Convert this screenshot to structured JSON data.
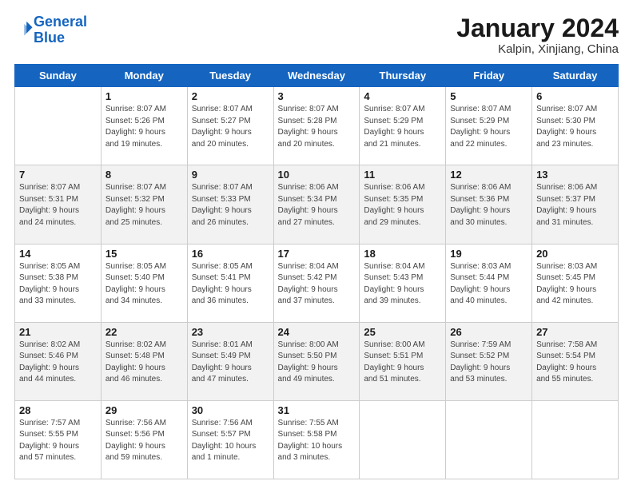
{
  "header": {
    "logo_line1": "General",
    "logo_line2": "Blue",
    "month": "January 2024",
    "location": "Kalpin, Xinjiang, China"
  },
  "weekdays": [
    "Sunday",
    "Monday",
    "Tuesday",
    "Wednesday",
    "Thursday",
    "Friday",
    "Saturday"
  ],
  "weeks": [
    [
      {
        "day": "",
        "info": ""
      },
      {
        "day": "1",
        "info": "Sunrise: 8:07 AM\nSunset: 5:26 PM\nDaylight: 9 hours\nand 19 minutes."
      },
      {
        "day": "2",
        "info": "Sunrise: 8:07 AM\nSunset: 5:27 PM\nDaylight: 9 hours\nand 20 minutes."
      },
      {
        "day": "3",
        "info": "Sunrise: 8:07 AM\nSunset: 5:28 PM\nDaylight: 9 hours\nand 20 minutes."
      },
      {
        "day": "4",
        "info": "Sunrise: 8:07 AM\nSunset: 5:29 PM\nDaylight: 9 hours\nand 21 minutes."
      },
      {
        "day": "5",
        "info": "Sunrise: 8:07 AM\nSunset: 5:29 PM\nDaylight: 9 hours\nand 22 minutes."
      },
      {
        "day": "6",
        "info": "Sunrise: 8:07 AM\nSunset: 5:30 PM\nDaylight: 9 hours\nand 23 minutes."
      }
    ],
    [
      {
        "day": "7",
        "info": "Sunrise: 8:07 AM\nSunset: 5:31 PM\nDaylight: 9 hours\nand 24 minutes."
      },
      {
        "day": "8",
        "info": "Sunrise: 8:07 AM\nSunset: 5:32 PM\nDaylight: 9 hours\nand 25 minutes."
      },
      {
        "day": "9",
        "info": "Sunrise: 8:07 AM\nSunset: 5:33 PM\nDaylight: 9 hours\nand 26 minutes."
      },
      {
        "day": "10",
        "info": "Sunrise: 8:06 AM\nSunset: 5:34 PM\nDaylight: 9 hours\nand 27 minutes."
      },
      {
        "day": "11",
        "info": "Sunrise: 8:06 AM\nSunset: 5:35 PM\nDaylight: 9 hours\nand 29 minutes."
      },
      {
        "day": "12",
        "info": "Sunrise: 8:06 AM\nSunset: 5:36 PM\nDaylight: 9 hours\nand 30 minutes."
      },
      {
        "day": "13",
        "info": "Sunrise: 8:06 AM\nSunset: 5:37 PM\nDaylight: 9 hours\nand 31 minutes."
      }
    ],
    [
      {
        "day": "14",
        "info": "Sunrise: 8:05 AM\nSunset: 5:38 PM\nDaylight: 9 hours\nand 33 minutes."
      },
      {
        "day": "15",
        "info": "Sunrise: 8:05 AM\nSunset: 5:40 PM\nDaylight: 9 hours\nand 34 minutes."
      },
      {
        "day": "16",
        "info": "Sunrise: 8:05 AM\nSunset: 5:41 PM\nDaylight: 9 hours\nand 36 minutes."
      },
      {
        "day": "17",
        "info": "Sunrise: 8:04 AM\nSunset: 5:42 PM\nDaylight: 9 hours\nand 37 minutes."
      },
      {
        "day": "18",
        "info": "Sunrise: 8:04 AM\nSunset: 5:43 PM\nDaylight: 9 hours\nand 39 minutes."
      },
      {
        "day": "19",
        "info": "Sunrise: 8:03 AM\nSunset: 5:44 PM\nDaylight: 9 hours\nand 40 minutes."
      },
      {
        "day": "20",
        "info": "Sunrise: 8:03 AM\nSunset: 5:45 PM\nDaylight: 9 hours\nand 42 minutes."
      }
    ],
    [
      {
        "day": "21",
        "info": "Sunrise: 8:02 AM\nSunset: 5:46 PM\nDaylight: 9 hours\nand 44 minutes."
      },
      {
        "day": "22",
        "info": "Sunrise: 8:02 AM\nSunset: 5:48 PM\nDaylight: 9 hours\nand 46 minutes."
      },
      {
        "day": "23",
        "info": "Sunrise: 8:01 AM\nSunset: 5:49 PM\nDaylight: 9 hours\nand 47 minutes."
      },
      {
        "day": "24",
        "info": "Sunrise: 8:00 AM\nSunset: 5:50 PM\nDaylight: 9 hours\nand 49 minutes."
      },
      {
        "day": "25",
        "info": "Sunrise: 8:00 AM\nSunset: 5:51 PM\nDaylight: 9 hours\nand 51 minutes."
      },
      {
        "day": "26",
        "info": "Sunrise: 7:59 AM\nSunset: 5:52 PM\nDaylight: 9 hours\nand 53 minutes."
      },
      {
        "day": "27",
        "info": "Sunrise: 7:58 AM\nSunset: 5:54 PM\nDaylight: 9 hours\nand 55 minutes."
      }
    ],
    [
      {
        "day": "28",
        "info": "Sunrise: 7:57 AM\nSunset: 5:55 PM\nDaylight: 9 hours\nand 57 minutes."
      },
      {
        "day": "29",
        "info": "Sunrise: 7:56 AM\nSunset: 5:56 PM\nDaylight: 9 hours\nand 59 minutes."
      },
      {
        "day": "30",
        "info": "Sunrise: 7:56 AM\nSunset: 5:57 PM\nDaylight: 10 hours\nand 1 minute."
      },
      {
        "day": "31",
        "info": "Sunrise: 7:55 AM\nSunset: 5:58 PM\nDaylight: 10 hours\nand 3 minutes."
      },
      {
        "day": "",
        "info": ""
      },
      {
        "day": "",
        "info": ""
      },
      {
        "day": "",
        "info": ""
      }
    ]
  ]
}
